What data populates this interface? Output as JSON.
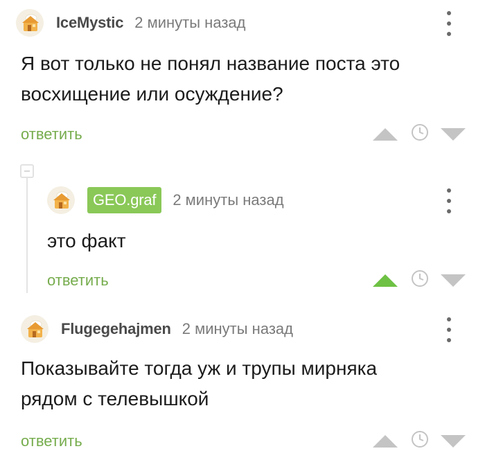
{
  "comments": [
    {
      "username": "IceMystic",
      "time": "2 минуты назад",
      "text": "Я вот только не понял название поста это\nвосхищение или осуждение?",
      "reply_label": "ответить",
      "voted_up": false
    },
    {
      "username": "GEO.graf",
      "time": "2 минуты назад",
      "text": "это факт",
      "reply_label": "ответить",
      "voted_up": true
    },
    {
      "username": "Flugegehajmen",
      "time": "2 минуты назад",
      "text": "Показывайте тогда уж и трупы мирняка\nрядом с телевышкой",
      "reply_label": "ответить",
      "voted_up": false
    }
  ],
  "icons": {
    "avatar": "default-avatar-icon",
    "menu": "more-vertical-icon",
    "upvote": "triangle-up-icon",
    "downvote": "triangle-down-icon",
    "clock": "clock-icon",
    "collapse": "collapse-minus-icon"
  },
  "colors": {
    "accent_green": "#76ac4d",
    "badge_green": "#8ac858",
    "vote_gray": "#c4c4c4",
    "vote_active": "#6ec144"
  }
}
